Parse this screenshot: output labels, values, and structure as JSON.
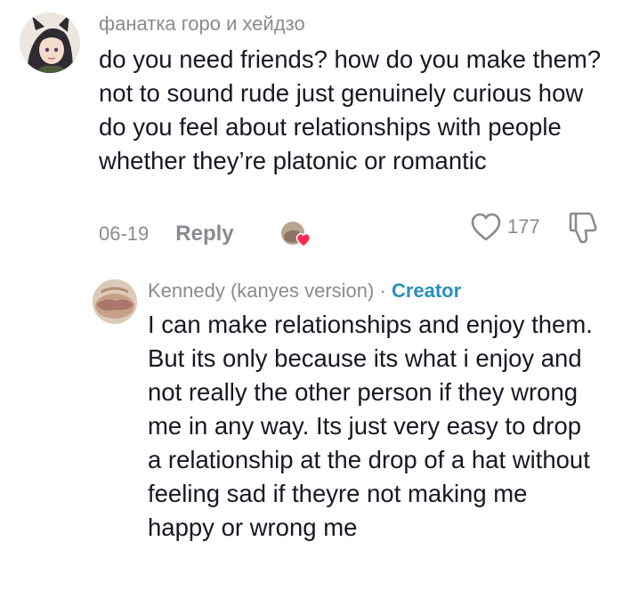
{
  "comment": {
    "username": "фанатка горо и хейдзо",
    "text": "do you need friends? how do you make them? not to sound rude just genuinely curious how do you feel about relationships with people whether they’re platonic or romantic",
    "date": "06-19",
    "reply_label": "Reply",
    "like_count": "177",
    "icons": [
      "heart-outline-icon",
      "dislike-icon"
    ],
    "creator_liked_badge": "creator-liked-heart"
  },
  "reply": {
    "username": "Kennedy (kanyes version)",
    "separator": "·",
    "badge": "Creator",
    "text": "I can make relationships and enjoy them. But its only because its what i enjoy and not really the other person if they wrong me in any way. Its just very easy to drop a relationship at the drop of a hat without feeling sad if theyre not making me happy or wrong me"
  },
  "colors": {
    "meta_gray": "#8a8b91",
    "creator_blue": "#2a8fb8",
    "heart_red": "#fe2c55",
    "text": "#161823"
  }
}
